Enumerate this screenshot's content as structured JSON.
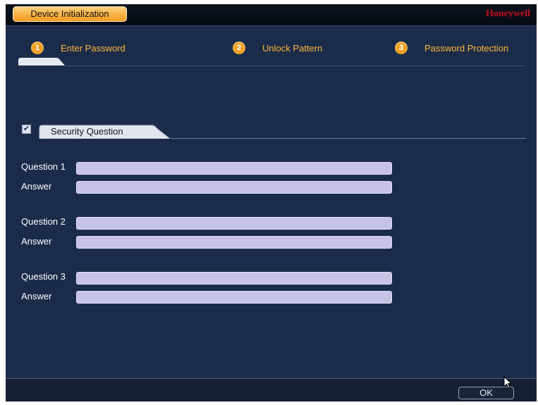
{
  "window": {
    "title": "Device Initialization",
    "brand": "Honeywell"
  },
  "steps": [
    {
      "number": "1",
      "label": "Enter Password"
    },
    {
      "number": "2",
      "label": "Unlock Pattern"
    },
    {
      "number": "3",
      "label": "Password Protection"
    }
  ],
  "security": {
    "checked": true,
    "check_glyph": "✔",
    "section_label": "Security Question",
    "fields": [
      {
        "question_label": "Question 1",
        "question_value": "",
        "answer_label": "Answer",
        "answer_value": ""
      },
      {
        "question_label": "Question 2",
        "question_value": "",
        "answer_label": "Answer",
        "answer_value": ""
      },
      {
        "question_label": "Question 3",
        "question_value": "",
        "answer_label": "Answer",
        "answer_value": ""
      }
    ]
  },
  "footer": {
    "ok_label": "OK"
  },
  "colors": {
    "background": "#1b2c4a",
    "accent": "#f0a227",
    "brand": "#c40c1c",
    "field": "#c7c3e5"
  },
  "icons": {
    "cursor": "mouse-pointer-icon",
    "checkbox": "check-icon"
  }
}
